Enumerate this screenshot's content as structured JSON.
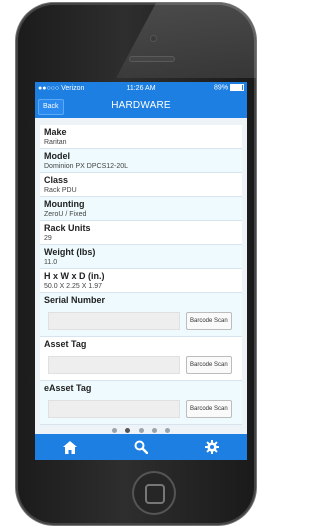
{
  "statusbar": {
    "carrier": "●●○○○ Verizon",
    "time": "11:26 AM",
    "battery": "89%"
  },
  "navbar": {
    "back_label": "Back",
    "title": "HARDWARE"
  },
  "fields": [
    {
      "label": "Make",
      "value": "Raritan"
    },
    {
      "label": "Model",
      "value": "Dominion PX DPCS12-20L"
    },
    {
      "label": "Class",
      "value": "Rack PDU"
    },
    {
      "label": "Mounting",
      "value": "ZeroU / Fixed"
    },
    {
      "label": "Rack Units",
      "value": "29"
    },
    {
      "label": "Weight (lbs)",
      "value": "11.0"
    },
    {
      "label": "H x W x D (in.)",
      "value": "50.0 X 2.25 X 1.97"
    }
  ],
  "inputs": [
    {
      "label": "Serial Number",
      "value": "",
      "button": "Barcode Scan"
    },
    {
      "label": "Asset Tag",
      "value": "",
      "button": "Barcode Scan"
    },
    {
      "label": "eAsset Tag",
      "value": "",
      "button": "Barcode Scan"
    }
  ],
  "pager": {
    "count": 5,
    "active": 1
  },
  "tabbar": {
    "items": [
      "home-icon",
      "search-icon",
      "gear-icon"
    ]
  },
  "colors": {
    "accent": "#1d7fe2",
    "row_alt": "#eefafd"
  }
}
